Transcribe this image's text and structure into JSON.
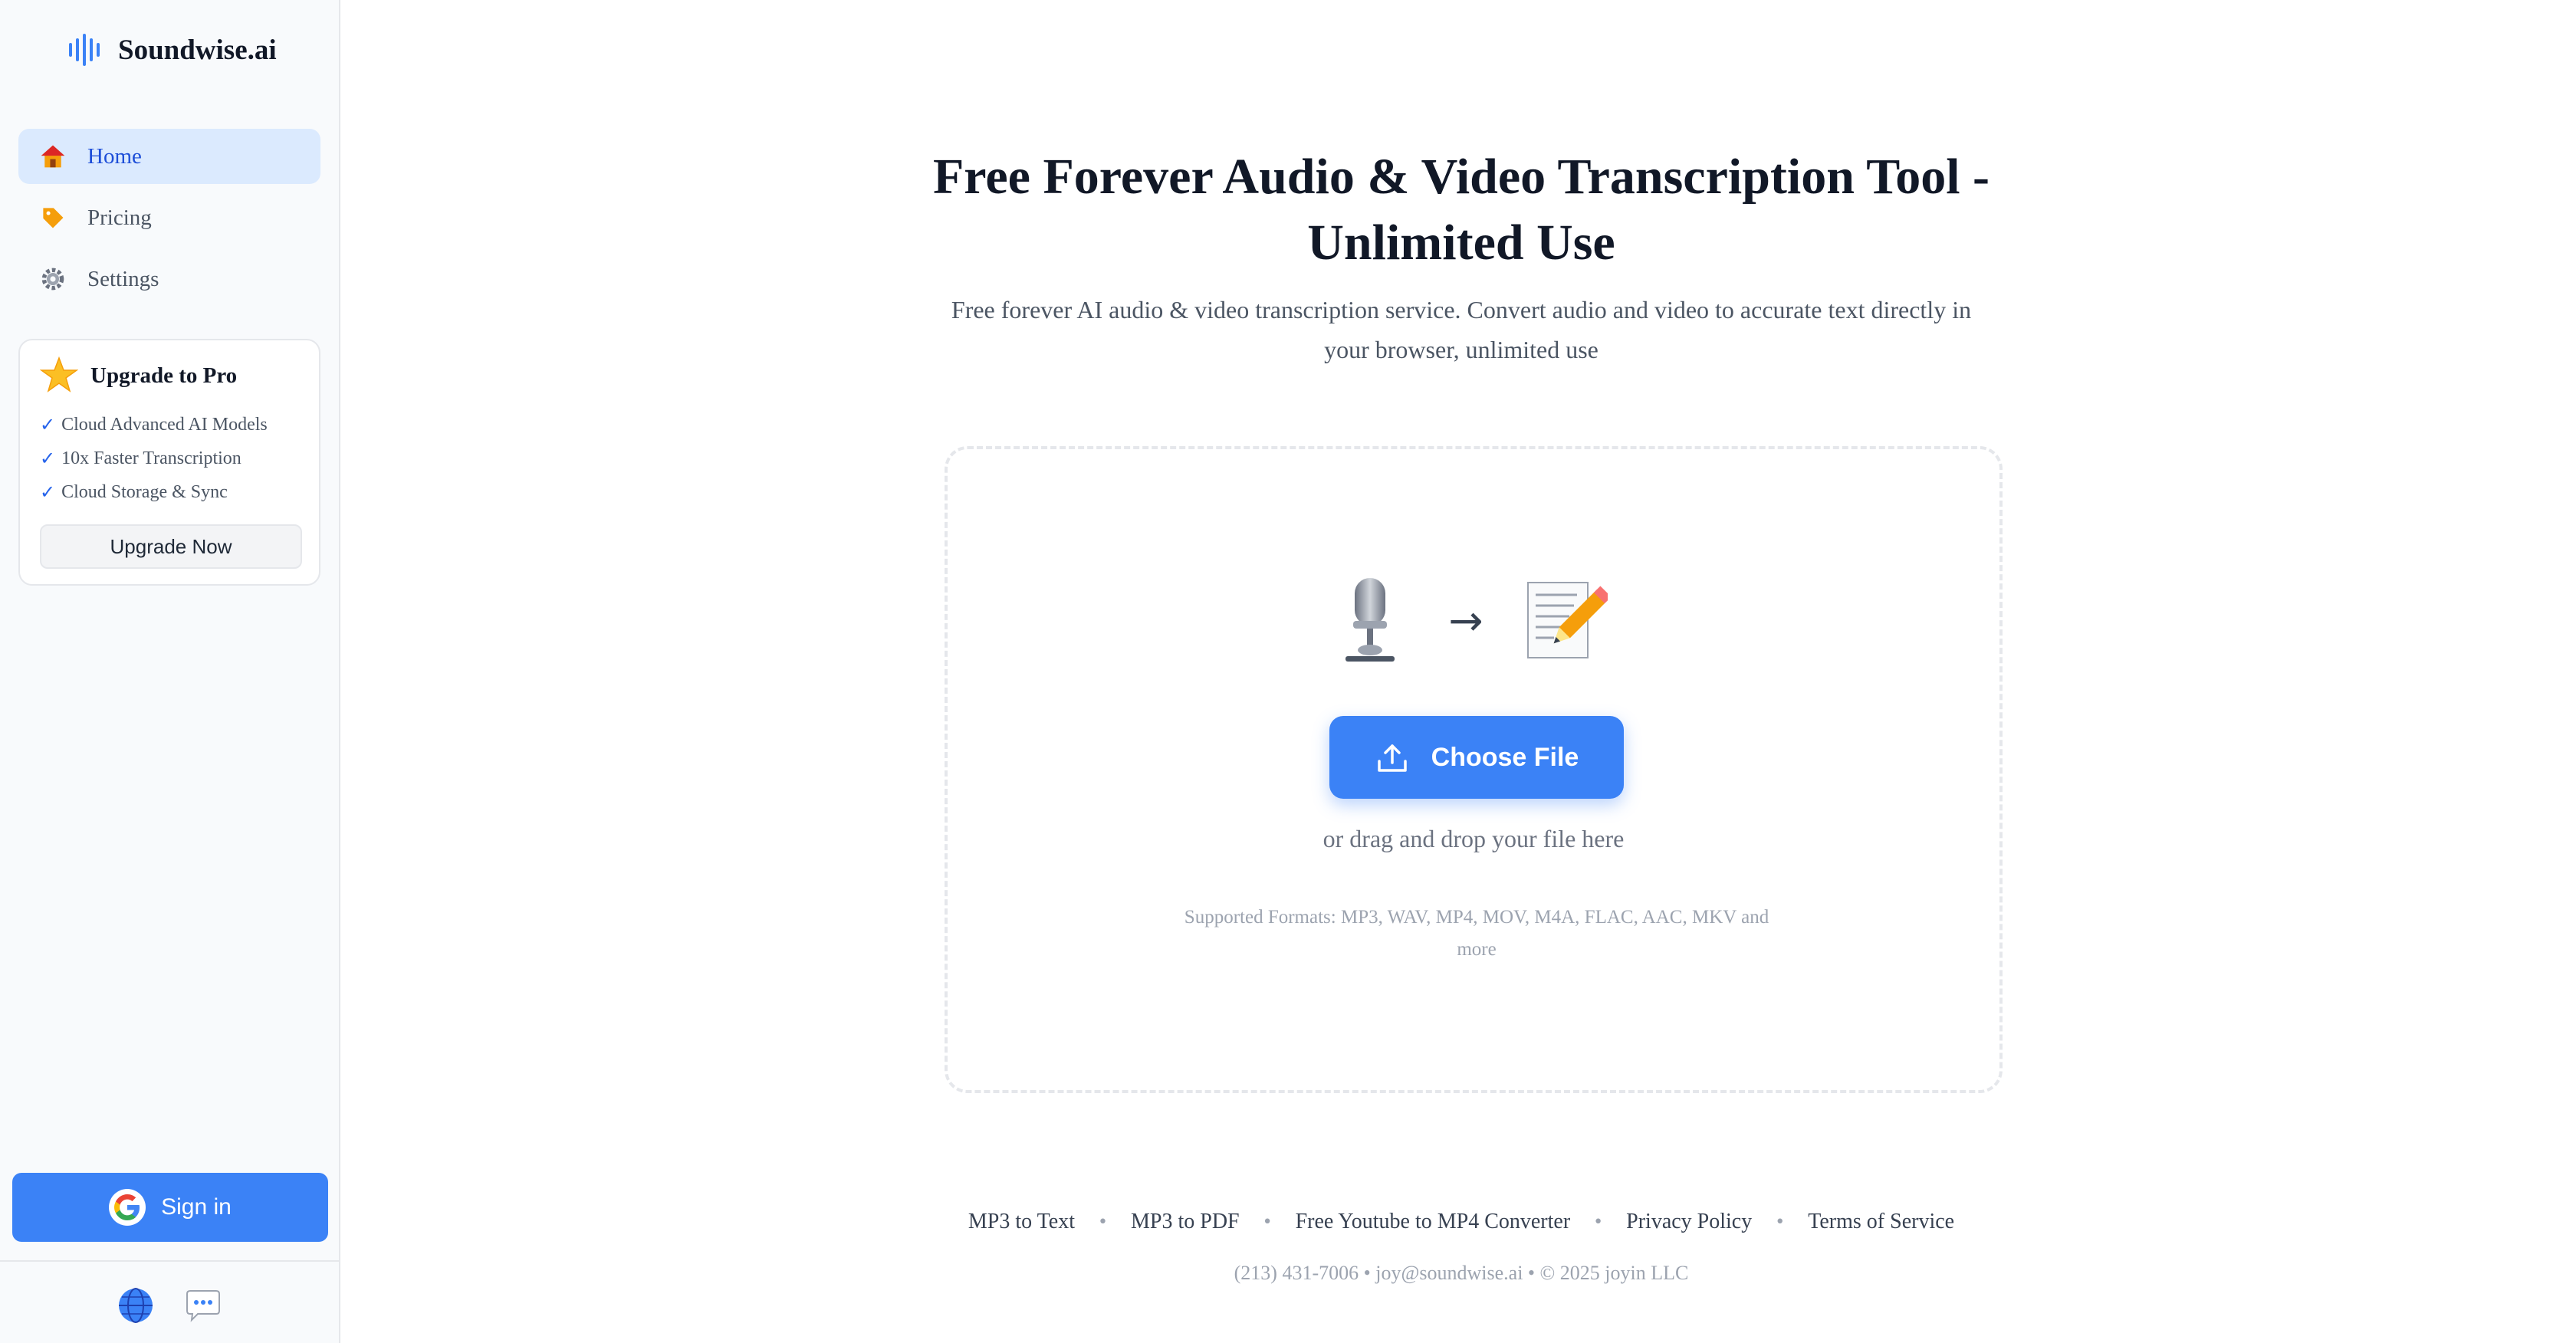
{
  "brand": {
    "name": "Soundwise.ai",
    "logo_icon": "soundwave-icon",
    "accent": "#3b82f6"
  },
  "sidebar": {
    "items": [
      {
        "label": "Home",
        "icon": "house-icon",
        "active": true
      },
      {
        "label": "Pricing",
        "icon": "tag-icon",
        "active": false
      },
      {
        "label": "Settings",
        "icon": "gear-icon",
        "active": false
      }
    ],
    "pro": {
      "title": "Upgrade to Pro",
      "icon": "star-icon",
      "features": [
        "Cloud Advanced AI Models",
        "10x Faster Transcription",
        "Cloud Storage & Sync"
      ],
      "check": "✓",
      "button": "Upgrade Now"
    },
    "signin": {
      "label": "Sign in",
      "icon": "google-icon"
    },
    "footer_icons": [
      "globe-icon",
      "chat-bubble-icon"
    ]
  },
  "hero": {
    "title": "Free Forever Audio & Video Transcription Tool - Unlimited Use",
    "subtitle": "Free forever AI audio & video transcription service. Convert audio and video to accurate text directly in your browser, unlimited use"
  },
  "upload": {
    "arrow": "→",
    "button": "Choose File",
    "drag_hint": "or drag and drop your file here",
    "formats": "Supported Formats: MP3, WAV, MP4, MOV, M4A, FLAC, AAC, MKV and more"
  },
  "footer": {
    "links": [
      "MP3 to Text",
      "MP3 to PDF",
      "Free Youtube to MP4 Converter",
      "Privacy Policy",
      "Terms of Service"
    ],
    "separator": "•",
    "contact": "(213) 431-7006 • joy@soundwise.ai • © 2025 joyin LLC"
  }
}
